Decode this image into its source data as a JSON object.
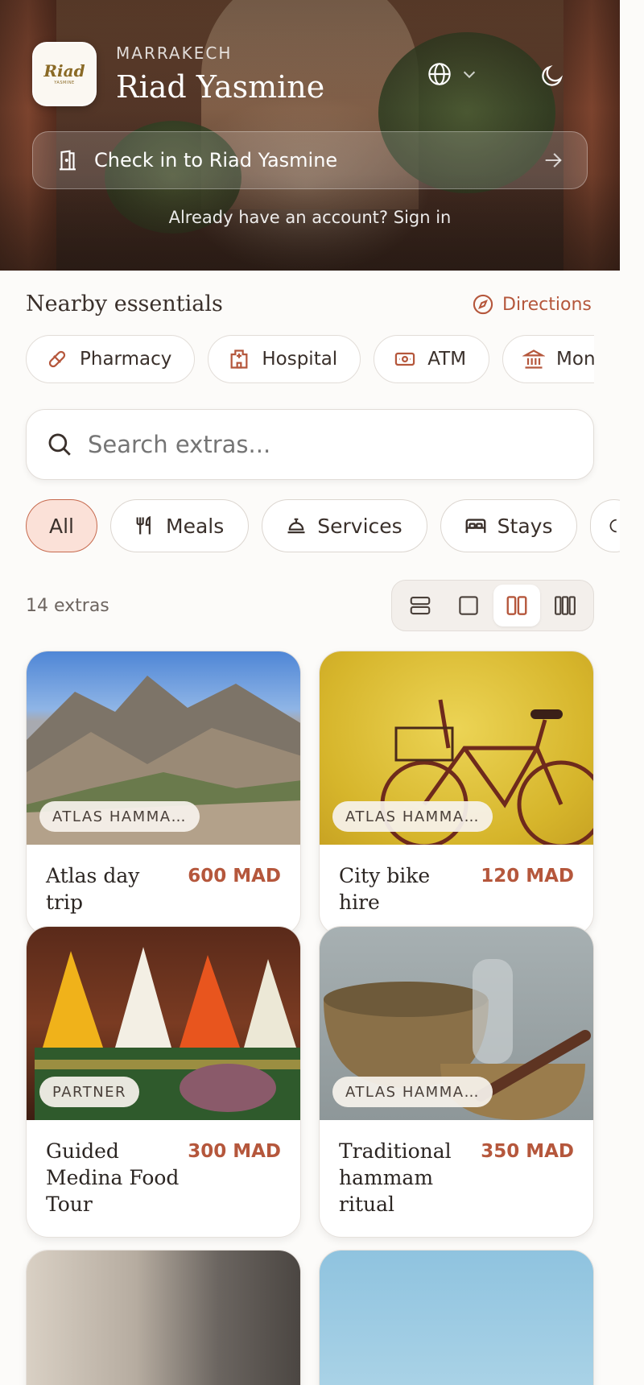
{
  "header": {
    "city": "MARRAKECH",
    "hotel_name": "Riad Yasmine",
    "logo_text": "Riad",
    "logo_sub": "YASMINE",
    "checkin_label": "Check in to Riad Yasmine",
    "signin_text": "Already have an account? Sign in"
  },
  "nearby": {
    "title": "Nearby essentials",
    "directions_label": "Directions",
    "items": [
      {
        "label": "Pharmacy",
        "icon": "pill-icon"
      },
      {
        "label": "Hospital",
        "icon": "hospital-icon"
      },
      {
        "label": "ATM",
        "icon": "banknote-icon"
      },
      {
        "label": "Mone",
        "icon": "bank-icon"
      }
    ]
  },
  "search": {
    "placeholder": "Search extras..."
  },
  "filters": [
    {
      "label": "All",
      "active": true
    },
    {
      "label": "Meals",
      "icon": "utensils-icon"
    },
    {
      "label": "Services",
      "icon": "concierge-bell-icon"
    },
    {
      "label": "Stays",
      "icon": "bed-icon"
    }
  ],
  "listing": {
    "count_text": "14 extras",
    "view_modes": [
      "list",
      "single",
      "two-column",
      "three-column"
    ],
    "active_view": "two-column"
  },
  "extras": [
    {
      "title": "Atlas day trip",
      "price": "600 MAD",
      "badge": "ATLAS HAMMA…"
    },
    {
      "title": "City bike hire",
      "price": "120 MAD",
      "badge": "ATLAS HAMMA…"
    },
    {
      "title": "Guided Medina Food Tour",
      "price": "300 MAD",
      "badge": "PARTNER"
    },
    {
      "title": "Traditional hammam ritual",
      "price": "350 MAD",
      "badge": "ATLAS HAMMA…"
    }
  ],
  "colors": {
    "accent": "#b5573c",
    "active_chip_bg": "#fbe1d8",
    "background": "#fcfbf9"
  }
}
